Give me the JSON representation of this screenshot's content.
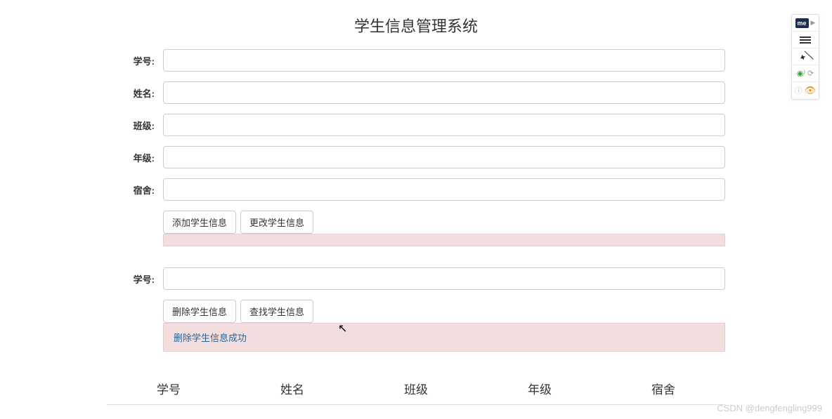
{
  "title": "学生信息管理系统",
  "form1": {
    "fields": [
      {
        "label": "学号:",
        "name": "student-id"
      },
      {
        "label": "姓名:",
        "name": "student-name"
      },
      {
        "label": "班级:",
        "name": "student-class"
      },
      {
        "label": "年级:",
        "name": "student-grade"
      },
      {
        "label": "宿舍:",
        "name": "student-dorm"
      }
    ],
    "buttons": {
      "add": "添加学生信息",
      "update": "更改学生信息"
    },
    "message": ""
  },
  "form2": {
    "field": {
      "label": "学号:",
      "name": "search-id"
    },
    "buttons": {
      "delete": "删除学生信息",
      "search": "查找学生信息"
    },
    "message": "删除学生信息成功"
  },
  "table": {
    "headers": [
      "学号",
      "姓名",
      "班级",
      "年级",
      "宿舍"
    ]
  },
  "toolbar": {
    "me": "me"
  },
  "watermark": "CSDN @dengfengling999"
}
